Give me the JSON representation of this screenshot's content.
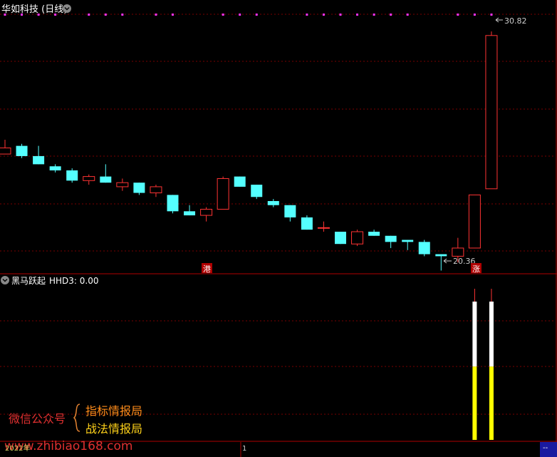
{
  "colors": {
    "background": "#000000",
    "up": "#ff3333",
    "down": "#54ffff",
    "grid": "#7a0000",
    "divider": "#b00000",
    "marker": "#ff33ff",
    "volume_white": "#ffffff",
    "volume_yellow": "#ffff00"
  },
  "main_panel": {
    "title": "华如科技 (日线)",
    "high_label": "30.82",
    "low_label": "20.36",
    "tag_gang": "港",
    "tag_zhang": "涨"
  },
  "sub_panel": {
    "title": "黑马跃起",
    "indicator": "HHD3: 0.00"
  },
  "watermark": {
    "left": "微信公众号",
    "line1": "指标情报局",
    "line2": "战法情报局",
    "url": "www.zhibiao168.com"
  },
  "bottom_bar": {
    "date_fragment": "2022年",
    "marker": "1",
    "corner": "--"
  },
  "chart_data": {
    "type": "candlestick",
    "price_range": [
      19.5,
      31.5
    ],
    "candles": [
      {
        "o": 24.8,
        "h": 25.5,
        "l": 24.8,
        "c": 25.1
      },
      {
        "o": 25.2,
        "h": 25.3,
        "l": 24.6,
        "c": 24.7
      },
      {
        "o": 24.7,
        "h": 25.2,
        "l": 24.3,
        "c": 24.3
      },
      {
        "o": 24.2,
        "h": 24.3,
        "l": 23.9,
        "c": 24.0
      },
      {
        "o": 24.0,
        "h": 24.1,
        "l": 23.4,
        "c": 23.5
      },
      {
        "o": 23.5,
        "h": 23.8,
        "l": 23.3,
        "c": 23.7
      },
      {
        "o": 23.7,
        "h": 24.3,
        "l": 23.4,
        "c": 23.4
      },
      {
        "o": 23.2,
        "h": 23.6,
        "l": 23.0,
        "c": 23.4
      },
      {
        "o": 23.4,
        "h": 23.4,
        "l": 22.8,
        "c": 22.9
      },
      {
        "o": 22.9,
        "h": 23.3,
        "l": 22.7,
        "c": 23.2
      },
      {
        "o": 22.8,
        "h": 22.8,
        "l": 21.9,
        "c": 22.0
      },
      {
        "o": 22.0,
        "h": 22.3,
        "l": 21.8,
        "c": 21.8
      },
      {
        "o": 21.8,
        "h": 22.2,
        "l": 21.5,
        "c": 22.1
      },
      {
        "o": 22.1,
        "h": 23.7,
        "l": 22.1,
        "c": 23.6
      },
      {
        "o": 23.7,
        "h": 23.7,
        "l": 23.2,
        "c": 23.2
      },
      {
        "o": 23.3,
        "h": 23.3,
        "l": 22.6,
        "c": 22.7
      },
      {
        "o": 22.5,
        "h": 22.6,
        "l": 22.2,
        "c": 22.3
      },
      {
        "o": 22.3,
        "h": 22.3,
        "l": 21.5,
        "c": 21.7
      },
      {
        "o": 21.7,
        "h": 21.8,
        "l": 21.1,
        "c": 21.1
      },
      {
        "o": 21.2,
        "h": 21.5,
        "l": 21.0,
        "c": 21.2
      },
      {
        "o": 21.0,
        "h": 21.0,
        "l": 20.4,
        "c": 20.4
      },
      {
        "o": 20.4,
        "h": 21.1,
        "l": 20.3,
        "c": 21.0
      },
      {
        "o": 21.0,
        "h": 21.1,
        "l": 20.8,
        "c": 20.8
      },
      {
        "o": 20.8,
        "h": 20.8,
        "l": 20.2,
        "c": 20.5
      },
      {
        "o": 20.6,
        "h": 20.6,
        "l": 20.1,
        "c": 20.5
      },
      {
        "o": 20.5,
        "h": 20.6,
        "l": 19.8,
        "c": 19.9
      },
      {
        "o": 19.9,
        "h": 19.9,
        "l": 19.1,
        "c": 19.8
      },
      {
        "o": 19.8,
        "h": 20.7,
        "l": 19.5,
        "c": 20.2
      },
      {
        "o": 20.2,
        "h": 22.8,
        "l": 20.2,
        "c": 22.8
      },
      {
        "o": 23.1,
        "h": 30.8,
        "l": 23.1,
        "c": 30.6
      }
    ],
    "volume": [
      {
        "index": 28,
        "top_white": 0.0,
        "value": 1.0
      },
      {
        "index": 29,
        "top_white": 0.55,
        "value": 1.0
      }
    ],
    "purple_markers": [
      0,
      1,
      2,
      3,
      5,
      6,
      7,
      9,
      10,
      13,
      14,
      15,
      18,
      19,
      20,
      21,
      22,
      23,
      24,
      27,
      28,
      29
    ]
  }
}
